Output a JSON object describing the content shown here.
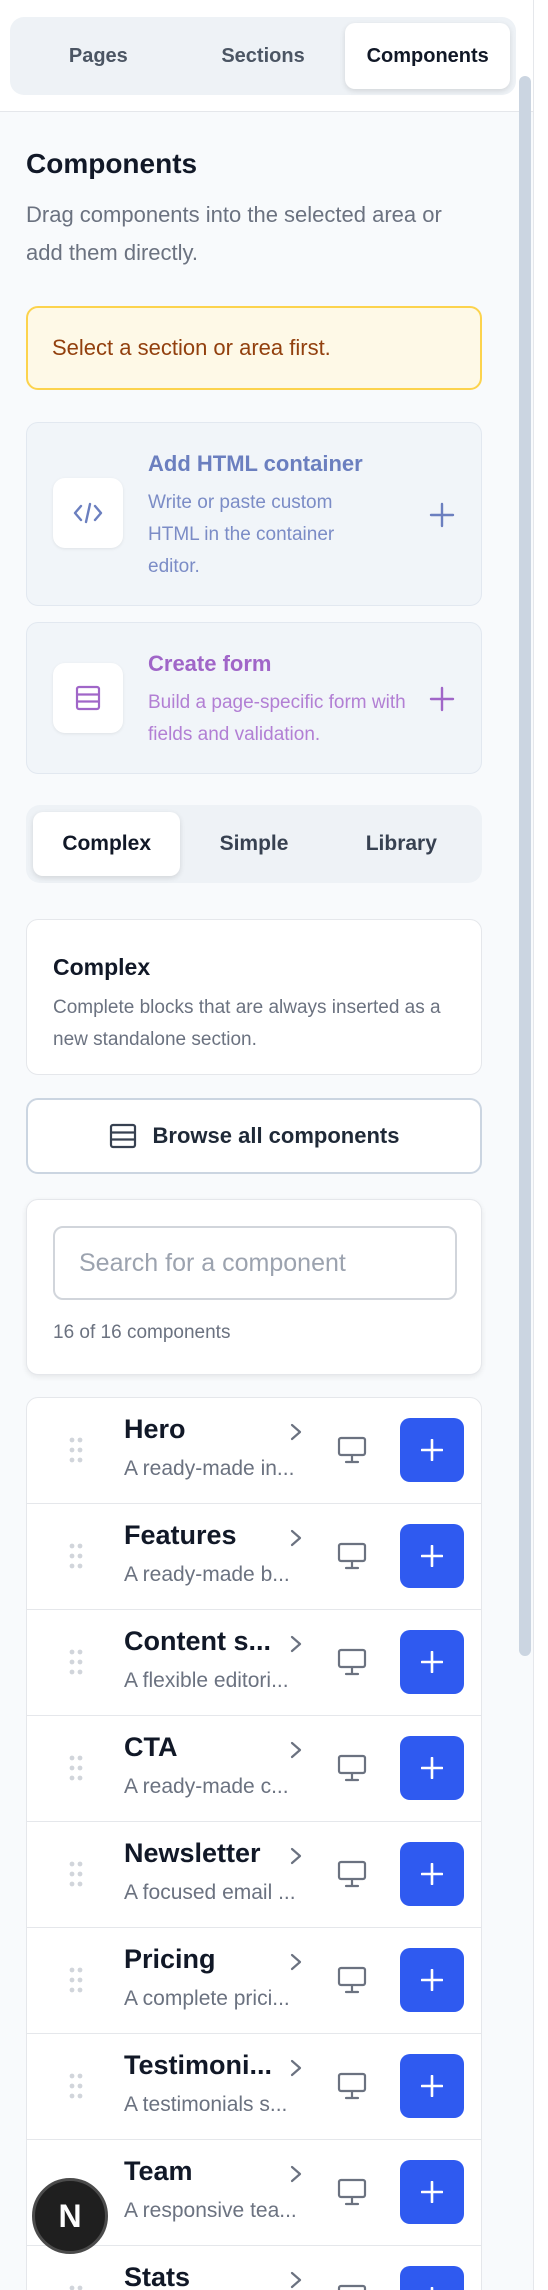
{
  "top_tabs": [
    "Pages",
    "Sections",
    "Components"
  ],
  "active_top_tab": "Components",
  "panel": {
    "title": "Components",
    "subtitle": "Drag components into the selected area or add them directly."
  },
  "alert": {
    "text": "Select a section or area first."
  },
  "html_container": {
    "title": "Add HTML container",
    "description": "Write or paste custom HTML in the container editor.",
    "color": "#6b7fbf"
  },
  "create_form": {
    "title": "Create form",
    "description": "Build a page-specific form with fields and validation.",
    "color": "#a066c8"
  },
  "type_tabs": [
    "Complex",
    "Simple",
    "Library"
  ],
  "active_type_tab": "Complex",
  "info": {
    "title": "Complex",
    "description": "Complete blocks that are always inserted as a new standalone section."
  },
  "browse_button": {
    "label": "Browse all components"
  },
  "search": {
    "placeholder": "Search for a component",
    "count_text": "16 of 16 components"
  },
  "components": [
    {
      "name": "Hero",
      "description": "A ready-made in..."
    },
    {
      "name": "Features",
      "description": "A ready-made b..."
    },
    {
      "name": "Content s...",
      "description": "A flexible editori..."
    },
    {
      "name": "CTA",
      "description": "A ready-made c..."
    },
    {
      "name": "Newsletter",
      "description": "A focused email ..."
    },
    {
      "name": "Pricing",
      "description": "A complete prici..."
    },
    {
      "name": "Testimoni...",
      "description": "A testimonials s..."
    },
    {
      "name": "Team",
      "description": "A responsive tea..."
    },
    {
      "name": "Stats",
      "description": ""
    }
  ],
  "fab": {
    "label": "N"
  },
  "colors": {
    "accent": "#2f5af0",
    "alert_bg": "#fef9e7",
    "alert_border": "#fcd34d",
    "alert_text": "#92400e"
  }
}
